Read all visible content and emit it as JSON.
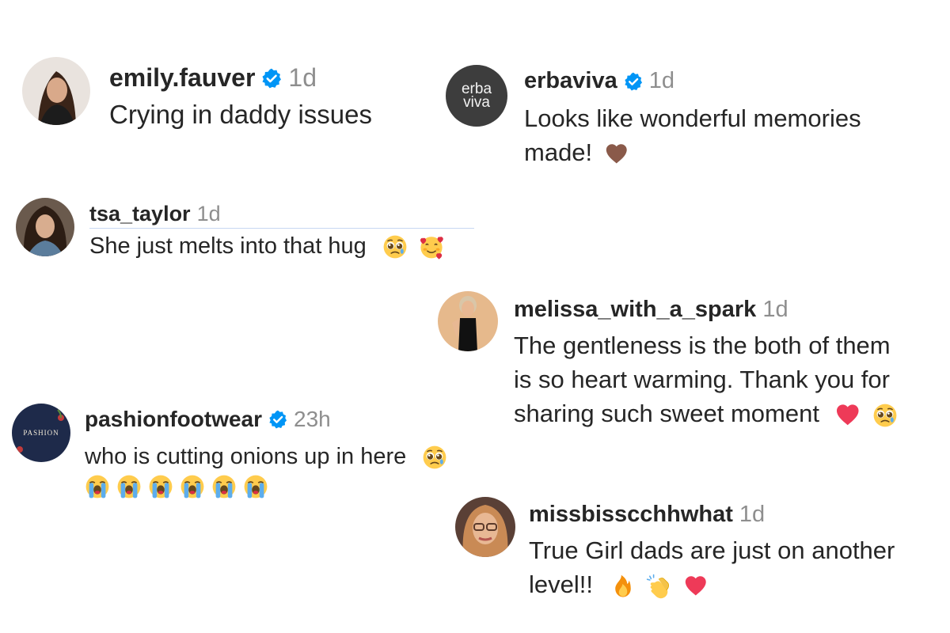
{
  "comments": [
    {
      "username": "emily.fauver",
      "verified": true,
      "time": "1d",
      "lines": [
        "Crying in daddy issues"
      ],
      "emoji": []
    },
    {
      "username": "erbaviva",
      "verified": true,
      "time": "1d",
      "avatar_text_top": "erba",
      "avatar_text_bottom": "viva",
      "lines": [
        "Looks like wonderful memories",
        "made!"
      ],
      "emoji": [
        "brown-heart"
      ]
    },
    {
      "username": "tsa_taylor",
      "verified": false,
      "time": "1d",
      "lines": [
        "She just melts into that hug"
      ],
      "emoji": [
        "pleading-face",
        "smiling-face-with-hearts"
      ]
    },
    {
      "username": "melissa_with_a_spark",
      "verified": false,
      "time": "1d",
      "lines": [
        "The gentleness is the both of them",
        "is so heart warming. Thank you for",
        "sharing such sweet moment"
      ],
      "emoji": [
        "red-heart",
        "pleading-face"
      ]
    },
    {
      "username": "pashionfootwear",
      "verified": true,
      "time": "23h",
      "avatar_text": "PASHION",
      "lines": [
        "who is cutting onions up in here"
      ],
      "emoji": [
        "pleading-face"
      ],
      "emoji_row": [
        "loudly-crying-face",
        "loudly-crying-face",
        "loudly-crying-face",
        "loudly-crying-face",
        "loudly-crying-face",
        "loudly-crying-face"
      ]
    },
    {
      "username": "missbisscchhwhat",
      "verified": false,
      "time": "1d",
      "lines": [
        "True Girl dads are just on another",
        "level!!"
      ],
      "emoji": [
        "fire",
        "clapping-hands",
        "red-heart"
      ]
    }
  ],
  "colors": {
    "verified": "#0095f6",
    "time": "#8e8e8e",
    "text": "#262626"
  }
}
